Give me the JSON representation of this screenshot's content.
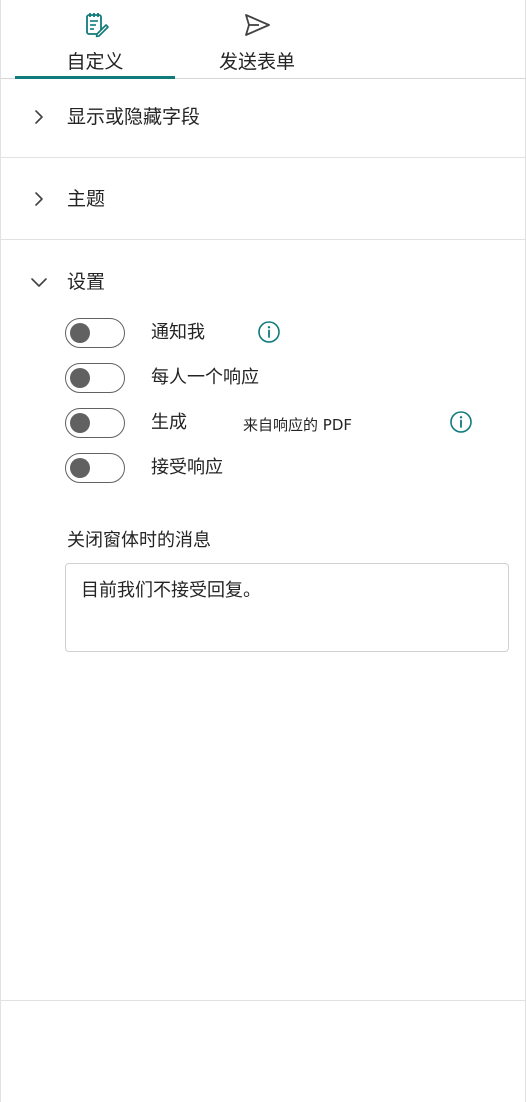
{
  "tabs": [
    {
      "label": "自定义",
      "icon": "form-edit-icon",
      "selected": true
    },
    {
      "label": "发送表单",
      "icon": "send-icon",
      "selected": false
    }
  ],
  "sections": {
    "show_hide_fields": {
      "label": "显示或隐藏字段",
      "expanded": false,
      "icon": "chevron-right-icon"
    },
    "theme": {
      "label": "主题",
      "expanded": false,
      "icon": "chevron-right-icon"
    },
    "settings": {
      "label": "设置",
      "expanded": true,
      "icon": "chevron-down-icon"
    }
  },
  "settings": {
    "toggles": [
      {
        "label": "通知我",
        "on": false,
        "has_info": true
      },
      {
        "label": "每人一个响应",
        "on": false,
        "has_info": false
      },
      {
        "label": "生成 来自响应的 PDF",
        "label_a": "生成",
        "label_b": "来自响应的 PDF",
        "on": false,
        "has_info": true
      },
      {
        "label": "接受响应",
        "on": false,
        "has_info": false
      }
    ],
    "closed_message": {
      "label": "关闭窗体时的消息",
      "value": "目前我们不接受回复。"
    }
  },
  "colors": {
    "accent": "#0f7b7a",
    "toggle_off": "#616161",
    "divider": "#e1e1e1"
  }
}
